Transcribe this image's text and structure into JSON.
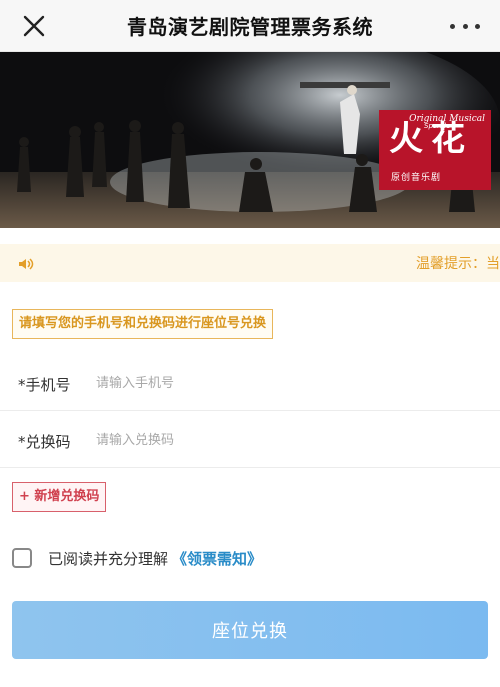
{
  "header": {
    "title": "青岛演艺剧院管理票务系统",
    "close_icon": "close-icon",
    "more_icon": "more-icon"
  },
  "banner": {
    "logo_main_1": "火",
    "logo_main_2": "花",
    "logo_en": "Original Musical",
    "logo_sparkle": "Sparkle",
    "logo_sub": "原创音乐剧",
    "brand_color": "#b8142a"
  },
  "notice": {
    "icon": "speaker-icon",
    "text": "温馨提示：当前"
  },
  "hint": {
    "text": "请填写您的手机号和兑换码进行座位号兑换"
  },
  "form": {
    "phone": {
      "label": "*手机号",
      "placeholder": "请输入手机号"
    },
    "code": {
      "label": "*兑换码",
      "placeholder": "请输入兑换码"
    }
  },
  "add_code": {
    "label": "+ 新增兑换码"
  },
  "agreement": {
    "text": "已阅读并充分理解",
    "link": "《领票需知》"
  },
  "submit": {
    "label": "座位兑换"
  },
  "colors": {
    "accent_orange": "#e39f2a",
    "link_blue": "#2a8cc8",
    "add_red": "#d0414f",
    "button_blue": "#7bbaf0"
  }
}
